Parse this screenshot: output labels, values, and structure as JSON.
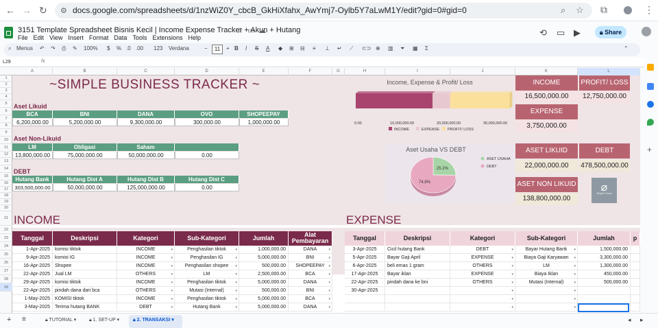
{
  "browser": {
    "url": "docs.google.com/spreadsheets/d/1nzWiZ0Y_cbcB_GkHiXfahx_AwYmj7-Oylb5Y7aLwM1Y/edit?gid=0#gid=0",
    "back_icon": "back-arrow-icon",
    "forward_icon": "forward-arrow-icon",
    "reload_icon": "reload-icon"
  },
  "doc": {
    "title": "3151 Template Spreadsheet Bisnis Kecil | Income Expense Tracker + Akun + Hutang",
    "menus": [
      "File",
      "Edit",
      "View",
      "Insert",
      "Format",
      "Data",
      "Tools",
      "Extensions",
      "Help"
    ],
    "share_label": "Share"
  },
  "toolbar": {
    "search": "Menus",
    "zoom": "100%",
    "font": "Verdana",
    "size": "11",
    "currency": "$",
    "percent": "%",
    "decimal1": ".0",
    "decimal2": ".00",
    "numfmt": "123"
  },
  "formula": {
    "cell": "L29"
  },
  "columns": [
    "A",
    "B",
    "C",
    "D",
    "E",
    "F",
    "G",
    "H",
    "I",
    "J",
    "K",
    "L"
  ],
  "rows": [
    "1",
    "2",
    "3",
    "4",
    "5",
    "6",
    "7",
    "8",
    "9",
    "10",
    "11",
    "12",
    "13",
    "14",
    "15",
    "16",
    "17",
    "18",
    "19",
    "20",
    "21",
    "22",
    "23",
    "24",
    "25",
    "26",
    "27",
    "28",
    "29"
  ],
  "main_title": "~SIMPLE BUSINESS TRACKER ~",
  "aset_likuid": {
    "title": "Aset Likuid",
    "headers": [
      "BCA",
      "BNI",
      "DANA",
      "OVO",
      "SHOPEEPAY"
    ],
    "values": [
      "6,200,000.00",
      "5,200,000.00",
      "9,300,000.00",
      "300,000.00",
      "1,000,000.00"
    ]
  },
  "aset_nonlikuid": {
    "title": "Aset Non-Likuid",
    "headers": [
      "LM",
      "Obligasi",
      "Saham",
      ""
    ],
    "values": [
      "13,800,000.00",
      "75,000,000.00",
      "50,000,000.00",
      "0.00"
    ]
  },
  "debt": {
    "title": "DEBT",
    "headers": [
      "Hutang Bank",
      "Hutang Dist A",
      "Hutang Dist B",
      "Hutang Dist C"
    ],
    "values": [
      "303,500,000.00",
      "50,000,000.00",
      "125,000,000.00",
      "0.00"
    ]
  },
  "kpi": {
    "income_label": "INCOME",
    "income_value": "16,500,000.00",
    "profit_label": "PROFIT/ LOSS",
    "profit_value": "12,750,000.00",
    "expense_label": "EXPENSE",
    "expense_value": "3,750,000.00",
    "aset_likuid_label": "ASET LIKUID",
    "aset_likuid_value": "22,000,000.00",
    "debt_label": "DEBT",
    "debt_value": "478,500,000.00",
    "aset_nonlikuid_label": "ASET NON LIKUID",
    "aset_nonlikuid_value": "138,800,000.00",
    "cloud_label": "Bright Cloud",
    "cloud_icon": "cloud-image-icon"
  },
  "chart_data": [
    {
      "type": "bar",
      "title": "Income, Expense & Profit/ Loss",
      "orientation": "horizontal",
      "stacked": true,
      "series": [
        {
          "name": "INCOME",
          "values": [
            16500000
          ],
          "color": "#a8446e"
        },
        {
          "name": "EXPENSE",
          "values": [
            3750000
          ],
          "color": "#e8c8d0"
        },
        {
          "name": "PROFIT/ LOSS",
          "values": [
            12750000
          ],
          "color": "#fbe09c"
        }
      ],
      "xlim": [
        0,
        30000000
      ],
      "ticks": [
        "0.00",
        "10,000,000.00",
        "20,000,000.00",
        "30,000,000.00"
      ],
      "legend": "bottom"
    },
    {
      "type": "pie",
      "title": "Aset Usaha VS DEBT",
      "series": [
        {
          "name": "ASET USAHA",
          "value": 25.2,
          "color": "#a8d5a8"
        },
        {
          "name": "DEBT",
          "value": 74.8,
          "color": "#e8a8c0"
        }
      ],
      "labels": [
        "25.2%",
        "74.8%"
      ],
      "legend": "right"
    }
  ],
  "income": {
    "title": "INCOME",
    "headers": [
      "Tanggal",
      "Deskripsi",
      "Kategori",
      "Sub-Kategori",
      "Jumlah",
      "Alat Pembayaran"
    ],
    "rows": [
      [
        "1-Apr-2025",
        "komisi tiktok",
        "INCOME",
        "Penghasilan tiktok",
        "1,000,000.00",
        "DANA"
      ],
      [
        "9-Apr-2025",
        "komisi IG",
        "INCOME",
        "Penghasilan IG",
        "5,000,000.00",
        "BNI"
      ],
      [
        "16-Apr-2025",
        "Shopee",
        "INCOME",
        "Penghasilan shopee",
        "500,000.00",
        "SHOPEEPAY"
      ],
      [
        "22-Apr-2025",
        "Jual LM",
        "OTHERS",
        "LM",
        "2,500,000.00",
        "BCA"
      ],
      [
        "29-Apr-2025",
        "komisi tiktok",
        "INCOME",
        "Penghasilan tiktok",
        "5,000,000.00",
        "DANA"
      ],
      [
        "22-Apr-2025",
        "pindah dana dari bca",
        "OTHERS",
        "Mutasi (Internal)",
        "500,000.00",
        "BNI"
      ],
      [
        "1-May-2025",
        "KOMISI tiktok",
        "INCOME",
        "Penghasilan tiktok",
        "5,000,000.00",
        "BCA"
      ],
      [
        "3-May-2025",
        "Terima hutang BANK",
        "DEBT",
        "Hutang Bank",
        "5,000,000.00",
        "DANA"
      ]
    ]
  },
  "expense": {
    "title": "EXPENSE",
    "headers": [
      "Tanggal",
      "Deskripsi",
      "Kategori",
      "Sub-Kategori",
      "Jumlah",
      "p"
    ],
    "rows": [
      [
        "3-Apr-2025",
        "Cicil hutang Bank",
        "DEBT",
        "Bayar Hutang Bank",
        "1,500,000.00"
      ],
      [
        "5-Apr-2025",
        "Bayar Gaji April",
        "EXPENSE",
        "Biaya Gaji Karyawan",
        "3,300,000.00"
      ],
      [
        "6-Apr-2025",
        "beli emas 1 gram",
        "OTHERS",
        "LM",
        "1,300,000.00"
      ],
      [
        "17-Apr-2025",
        "Bayar iklan",
        "EXPENSE",
        "Biaya Iklan",
        "450,000.00"
      ],
      [
        "22-Apr-2025",
        "pindah dana ke bni",
        "OTHERS",
        "Mutasi (Internal)",
        "500,000.00"
      ],
      [
        "30-Apr-2025",
        "",
        "",
        "",
        ""
      ],
      [
        "",
        "",
        "",
        "",
        ""
      ],
      [
        "",
        "",
        "",
        "",
        ""
      ]
    ]
  },
  "tabs": [
    "TUTORIAL",
    "1. SET-UP",
    "2. TRANSAKSI"
  ]
}
